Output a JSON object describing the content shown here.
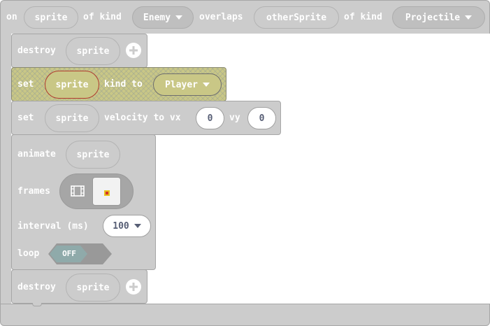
{
  "event_block": {
    "on_label": "on",
    "sprite_param": "sprite",
    "of_kind_label": "of kind",
    "kind_value": "Enemy",
    "overlaps_label": "overlaps",
    "other_sprite_param": "otherSprite",
    "of_kind_label_2": "of kind",
    "other_kind_value": "Projectile"
  },
  "destroy_block_1": {
    "keyword": "destroy",
    "arg": "sprite"
  },
  "set_kind_block": {
    "set_label": "set",
    "arg": "sprite",
    "kind_to_label": "kind to",
    "kind_value": "Player"
  },
  "set_velocity_block": {
    "set_label": "set",
    "arg": "sprite",
    "velocity_label": "velocity to vx",
    "vx_value": "0",
    "vy_label": "vy",
    "vy_value": "0"
  },
  "animate_block": {
    "keyword": "animate",
    "arg": "sprite",
    "frames_label": "frames",
    "interval_label": "interval (ms)",
    "interval_value": "100",
    "loop_label": "loop",
    "loop_value": "OFF"
  },
  "destroy_block_2": {
    "keyword": "destroy",
    "arg": "sprite"
  },
  "icons": {
    "filmstrip": "filmstrip-icon",
    "plus": "plus-icon",
    "caret": "dropdown-caret-icon"
  },
  "colors": {
    "block": "#cccccc",
    "highlight": "#c9c786",
    "toggle": "#8faaaa"
  }
}
